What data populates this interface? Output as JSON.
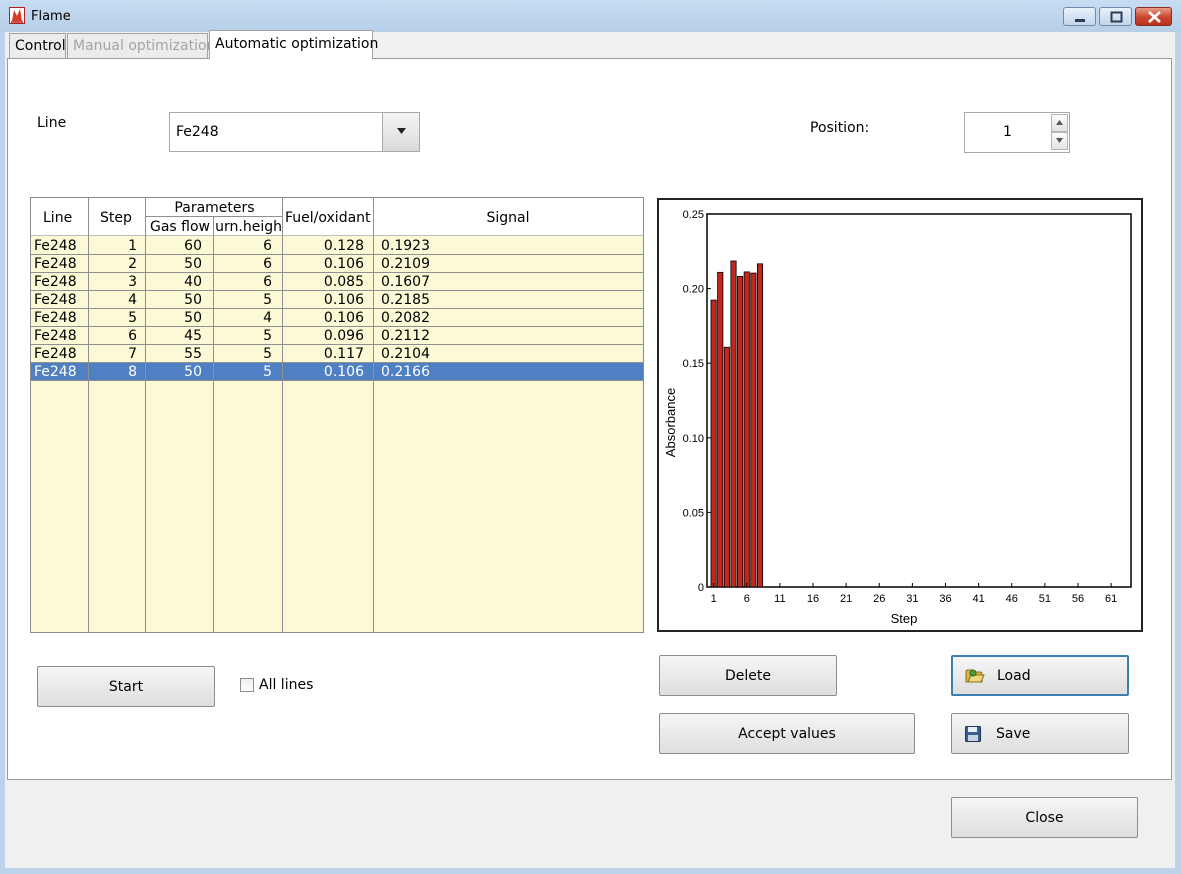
{
  "window": {
    "title": "Flame"
  },
  "tabs": [
    {
      "label": "Control",
      "state": "normal"
    },
    {
      "label": "Manual optimization",
      "state": "disabled"
    },
    {
      "label": "Automatic optimization",
      "state": "selected"
    }
  ],
  "line": {
    "label": "Line",
    "selected": "Fe248"
  },
  "position": {
    "label": "Position:",
    "value": "1"
  },
  "grid": {
    "columns": {
      "line": "Line",
      "step": "Step",
      "parameters": "Parameters",
      "gas_flow": "Gas flow",
      "burn_height": "Burn.heigh",
      "fuel_oxidant": "Fuel/oxidant",
      "signal": "Signal"
    },
    "rows": [
      {
        "line": "Fe248",
        "step": "1",
        "gas_flow": "60",
        "burn_height": "6",
        "fuel_oxidant": "0.128",
        "signal": "0.1923"
      },
      {
        "line": "Fe248",
        "step": "2",
        "gas_flow": "50",
        "burn_height": "6",
        "fuel_oxidant": "0.106",
        "signal": "0.2109"
      },
      {
        "line": "Fe248",
        "step": "3",
        "gas_flow": "40",
        "burn_height": "6",
        "fuel_oxidant": "0.085",
        "signal": "0.1607"
      },
      {
        "line": "Fe248",
        "step": "4",
        "gas_flow": "50",
        "burn_height": "5",
        "fuel_oxidant": "0.106",
        "signal": "0.2185"
      },
      {
        "line": "Fe248",
        "step": "5",
        "gas_flow": "50",
        "burn_height": "4",
        "fuel_oxidant": "0.106",
        "signal": "0.2082"
      },
      {
        "line": "Fe248",
        "step": "6",
        "gas_flow": "45",
        "burn_height": "5",
        "fuel_oxidant": "0.096",
        "signal": "0.2112"
      },
      {
        "line": "Fe248",
        "step": "7",
        "gas_flow": "55",
        "burn_height": "5",
        "fuel_oxidant": "0.117",
        "signal": "0.2104"
      },
      {
        "line": "Fe248",
        "step": "8",
        "gas_flow": "50",
        "burn_height": "5",
        "fuel_oxidant": "0.106",
        "signal": "0.2166"
      }
    ],
    "selected_row": 7
  },
  "chart_data": {
    "type": "bar",
    "x": [
      1,
      2,
      3,
      4,
      5,
      6,
      7,
      8
    ],
    "values": [
      0.1923,
      0.2109,
      0.1607,
      0.2185,
      0.2082,
      0.2112,
      0.2104,
      0.2166
    ],
    "xlabel": "Step",
    "ylabel": "Absorbance",
    "xlim": [
      0,
      64
    ],
    "ylim": [
      0,
      0.25
    ],
    "xticks": [
      "1",
      "6",
      "11",
      "16",
      "21",
      "26",
      "31",
      "36",
      "41",
      "46",
      "51",
      "56",
      "61"
    ],
    "yticks": [
      "0",
      "0.05",
      "0.10",
      "0.15",
      "0.20",
      "0.25"
    ],
    "ytick_values": [
      0,
      0.05,
      0.1,
      0.15,
      0.2,
      0.25
    ],
    "bar_color": "#c0281e",
    "grid": false
  },
  "controls": {
    "start": "Start",
    "all_lines": "All lines",
    "all_lines_checked": false,
    "delete": "Delete",
    "accept_values": "Accept values",
    "load": "Load",
    "save": "Save",
    "close": "Close"
  },
  "colors": {
    "selection": "#5080c4",
    "grid_background": "#fcf9d6",
    "window_frame": "#bcd3ea"
  }
}
